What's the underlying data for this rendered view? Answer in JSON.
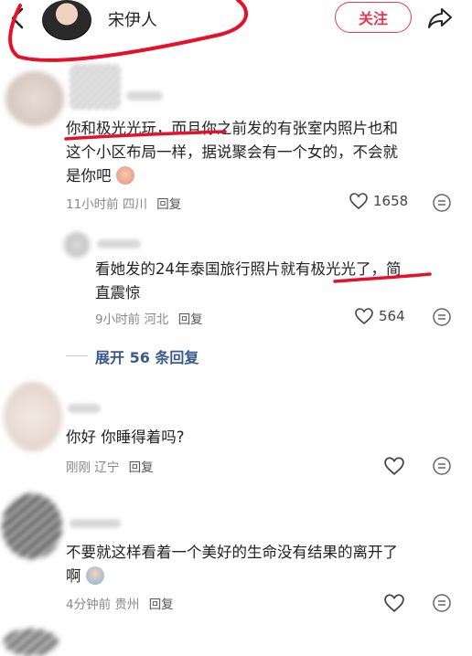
{
  "header": {
    "user_name": "宋伊人",
    "follow_label": "关注",
    "back_icon": "back-icon",
    "share_icon": "share-icon"
  },
  "comments": [
    {
      "text_line1": "你和极光光玩，而且你之前发的有张室内照片也和",
      "text_line2": "这个小区布局一样，据说聚会有一个女的，不会就",
      "text_line3": "是你吧",
      "time": "11小时前",
      "location": "四川",
      "reply": "回复",
      "likes": "1658"
    },
    {
      "text_line1": "看她发的24年泰国旅行照片就有极光光了，简",
      "text_line2": "直震惊",
      "time": "9小时前",
      "location": "河北",
      "reply": "回复",
      "likes": "564"
    },
    {
      "expand_label": "展开 56 条回复"
    },
    {
      "text_line1": "你好 你睡得着吗?",
      "time": "刚刚",
      "location": "辽宁",
      "reply": "回复"
    },
    {
      "text_line1": "不要就这样看着一个美好的生命没有结果的离开了",
      "text_line2": "啊",
      "time": "4分钟前",
      "location": "贵州",
      "reply": "回复"
    }
  ],
  "colors": {
    "accent_red": "#e23b4f",
    "annotation_red": "#e5102a",
    "link_blue": "#3a5a8c"
  }
}
